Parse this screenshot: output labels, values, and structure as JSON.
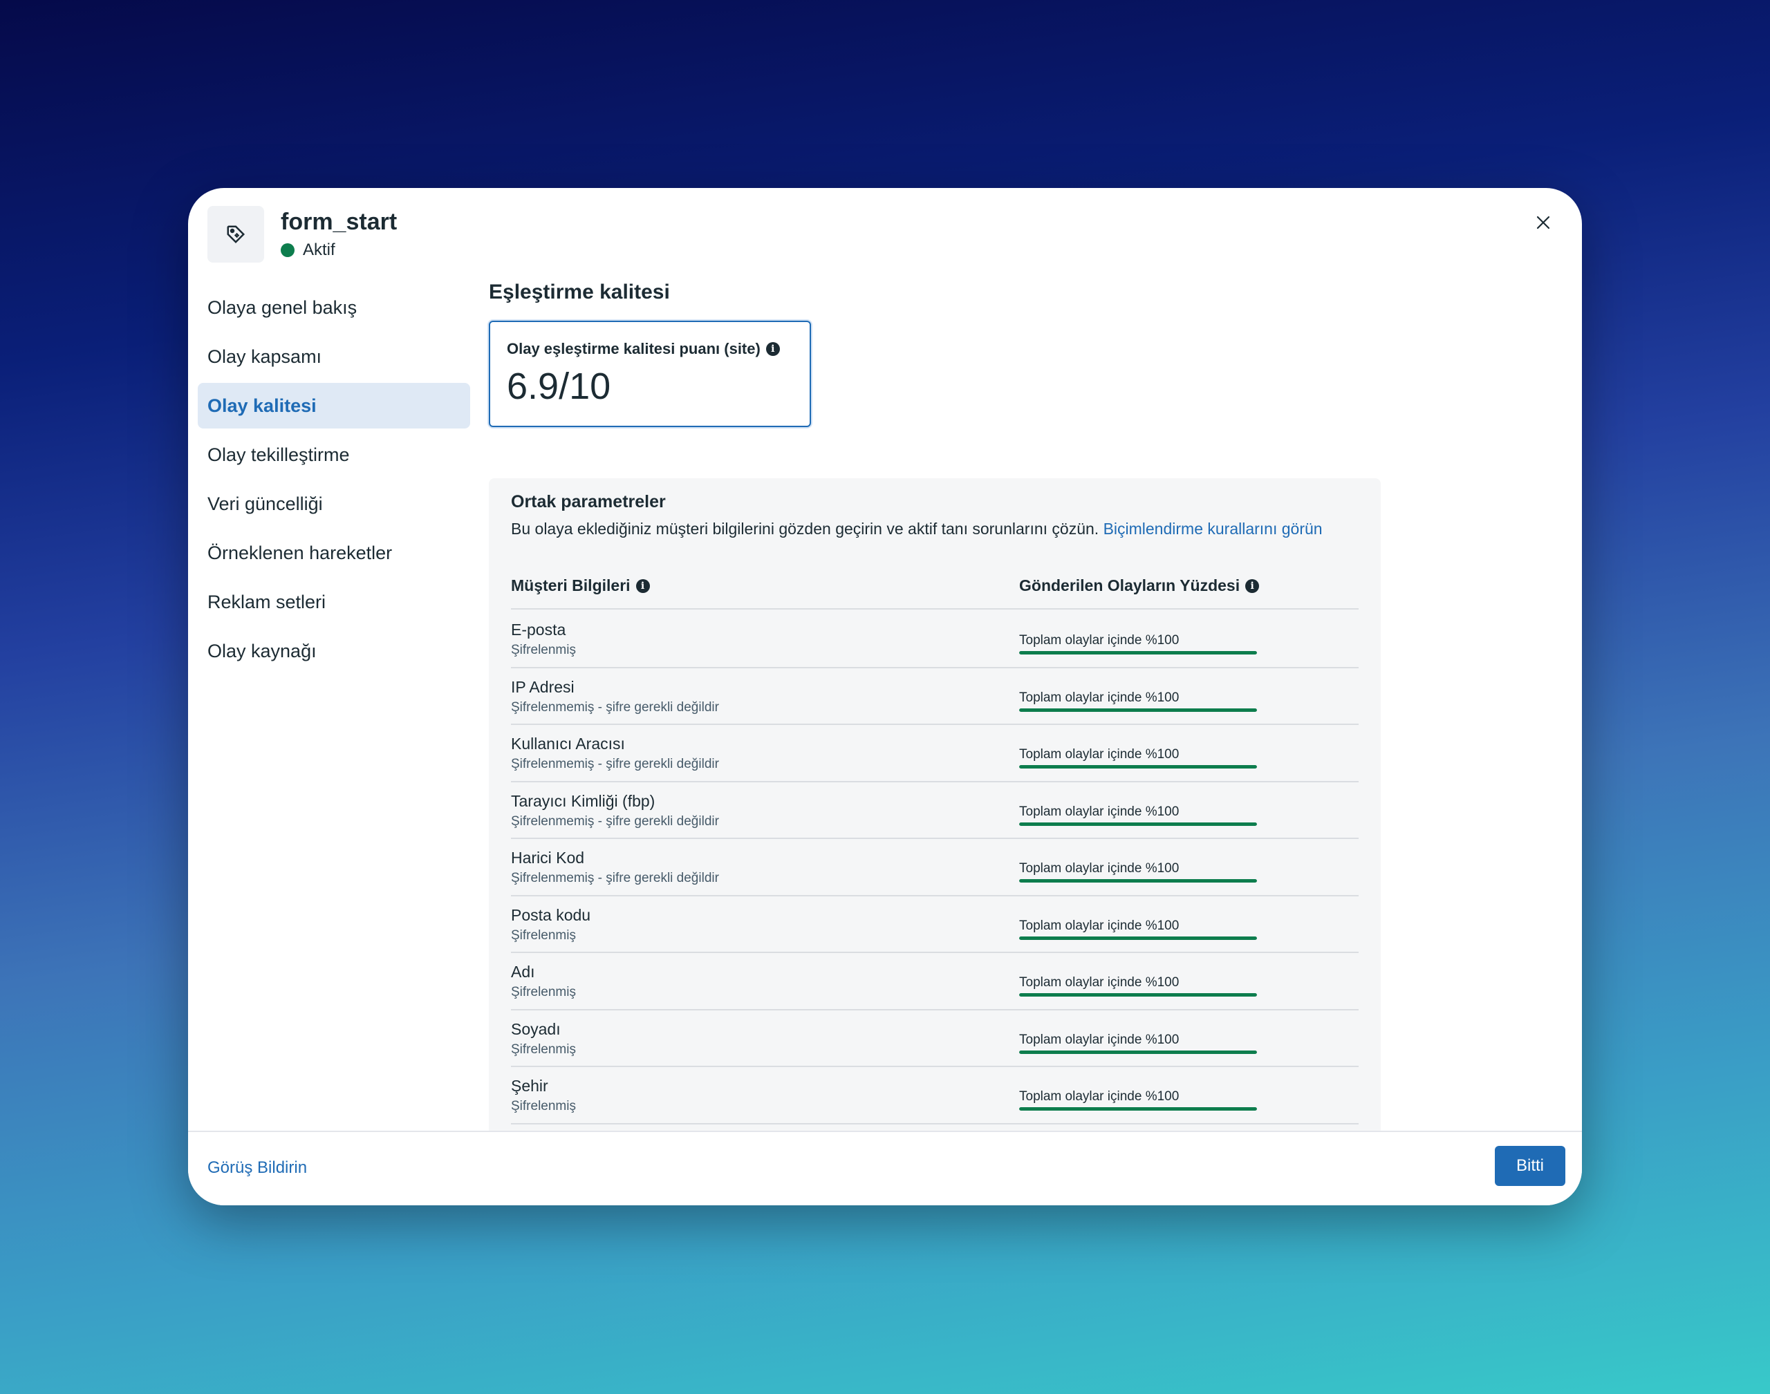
{
  "header": {
    "title": "form_start",
    "status": "Aktif",
    "icon": "tag-icon",
    "status_color": "#0d7d4d"
  },
  "sidebar": {
    "items": [
      {
        "label": "Olaya genel bakış",
        "active": false
      },
      {
        "label": "Olay kapsamı",
        "active": false
      },
      {
        "label": "Olay kalitesi",
        "active": true
      },
      {
        "label": "Olay tekilleştirme",
        "active": false
      },
      {
        "label": "Veri güncelliği",
        "active": false
      },
      {
        "label": "Örneklenen hareketler",
        "active": false
      },
      {
        "label": "Reklam setleri",
        "active": false
      },
      {
        "label": "Olay kaynağı",
        "active": false
      }
    ]
  },
  "main": {
    "section_title": "Eşleştirme kalitesi",
    "score_card": {
      "label": "Olay eşleştirme kalitesi puanı (site)",
      "value": "6.9/10"
    },
    "params": {
      "title": "Ortak parametreler",
      "description": "Bu olaya eklediğiniz müşteri bilgilerini gözden geçirin ve aktif tanı sorunlarını çözün.",
      "link": "Biçimlendirme kurallarını görün",
      "col_left": "Müşteri Bilgileri",
      "col_right": "Gönderilen Olayların Yüzdesi",
      "rows": [
        {
          "name": "E-posta",
          "sub": "Şifrelenmiş",
          "pct_text": "Toplam olaylar içinde %100",
          "pct": 100
        },
        {
          "name": "IP Adresi",
          "sub": "Şifrelenmemiş - şifre gerekli değildir",
          "pct_text": "Toplam olaylar içinde %100",
          "pct": 100
        },
        {
          "name": "Kullanıcı Aracısı",
          "sub": "Şifrelenmemiş - şifre gerekli değildir",
          "pct_text": "Toplam olaylar içinde %100",
          "pct": 100
        },
        {
          "name": "Tarayıcı Kimliği (fbp)",
          "sub": "Şifrelenmemiş - şifre gerekli değildir",
          "pct_text": "Toplam olaylar içinde %100",
          "pct": 100
        },
        {
          "name": "Harici Kod",
          "sub": "Şifrelenmemiş - şifre gerekli değildir",
          "pct_text": "Toplam olaylar içinde %100",
          "pct": 100
        },
        {
          "name": "Posta kodu",
          "sub": "Şifrelenmiş",
          "pct_text": "Toplam olaylar içinde %100",
          "pct": 100
        },
        {
          "name": "Adı",
          "sub": "Şifrelenmiş",
          "pct_text": "Toplam olaylar içinde %100",
          "pct": 100
        },
        {
          "name": "Soyadı",
          "sub": "Şifrelenmiş",
          "pct_text": "Toplam olaylar içinde %100",
          "pct": 100
        },
        {
          "name": "Şehir",
          "sub": "Şifrelenmiş",
          "pct_text": "Toplam olaylar içinde %100",
          "pct": 100
        }
      ]
    }
  },
  "footer": {
    "feedback": "Görüş Bildirin",
    "done": "Bitti"
  },
  "colors": {
    "accent": "#1f6bb5",
    "success": "#0d7d4d"
  }
}
